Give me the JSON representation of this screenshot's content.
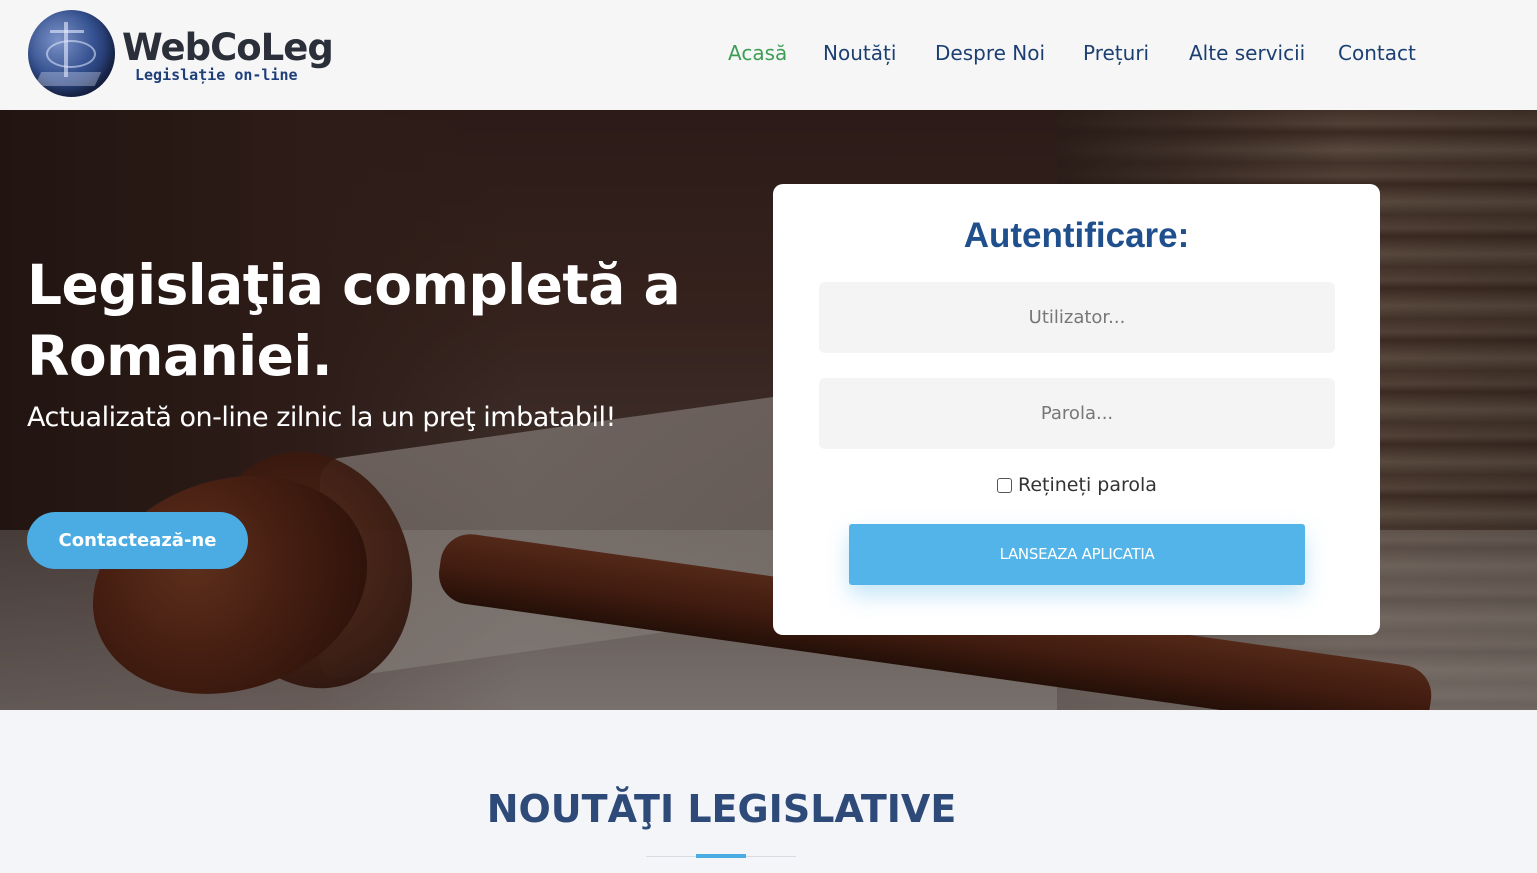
{
  "header": {
    "logo": {
      "title": "WebCoLeg",
      "subtitle": "Legislație on-line"
    },
    "nav": [
      {
        "label": "Acasă",
        "active": true
      },
      {
        "label": "Noutăți",
        "active": false
      },
      {
        "label": "Despre Noi",
        "active": false
      },
      {
        "label": "Prețuri",
        "active": false
      },
      {
        "label": "Alte servicii",
        "active": false
      },
      {
        "label": "Contact",
        "active": false
      }
    ]
  },
  "hero": {
    "title": "Legislaţia completă a Romaniei.",
    "subtitle": "Actualizată on-line zilnic la un preţ imbatabil!",
    "contact_button": "Contactează-ne"
  },
  "login": {
    "title": "Autentificare:",
    "username_placeholder": "Utilizator...",
    "password_placeholder": "Parola...",
    "remember_label": "Rețineți parola",
    "remember_checked": false,
    "submit_label": "LANSEAZA APLICATIA"
  },
  "section": {
    "title": "NOUTĂŢI LEGISLATIVE"
  },
  "colors": {
    "nav_text": "#1c3f72",
    "nav_active": "#3c9d55",
    "accent": "#4aace3",
    "login_title": "#1f4f8c",
    "section_title": "#2e4a78"
  }
}
